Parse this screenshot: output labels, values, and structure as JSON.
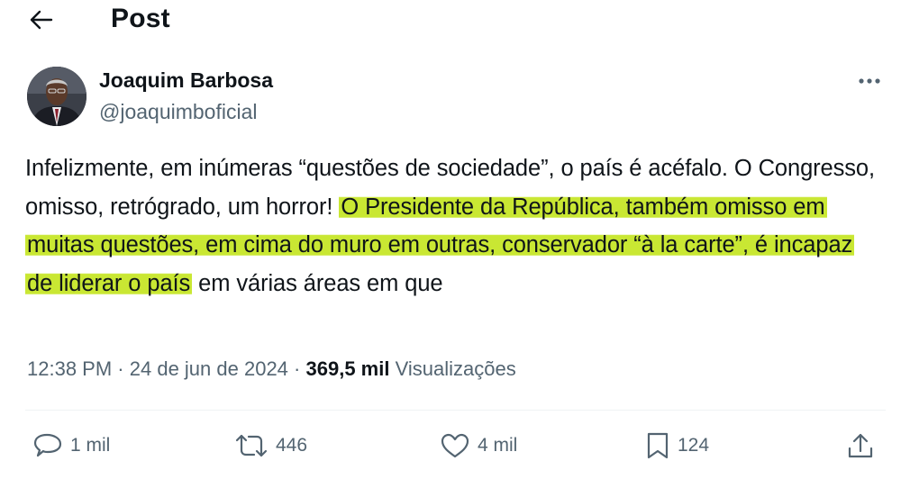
{
  "header": {
    "title": "Post",
    "back_icon": "arrow-left-icon"
  },
  "author": {
    "name": "Joaquim Barbosa",
    "handle": "@joaquimboficial"
  },
  "post": {
    "text_before": "Infelizmente, em inúmeras “questões de sociedade”, o país é acéfalo. O Congresso, omisso, retrógrado, um horror! ",
    "text_highlighted": "O Presidente da República, também omisso em muitas questões, em cima do muro em outras, conservador “à la carte”, é incapaz de liderar o país",
    "text_after": " em várias áreas em que",
    "highlight_color": "#c6e628"
  },
  "meta": {
    "time": "12:38 PM",
    "separator": "·",
    "date": "24 de jun de 2024",
    "views_count": "369,5 mil",
    "views_label": "Visualizações"
  },
  "actions": {
    "reply": {
      "icon": "reply-icon",
      "count": "1 mil"
    },
    "repost": {
      "icon": "repost-icon",
      "count": "446"
    },
    "like": {
      "icon": "heart-icon",
      "count": "4 mil"
    },
    "bookmark": {
      "icon": "bookmark-icon",
      "count": "124"
    },
    "share": {
      "icon": "share-icon"
    }
  }
}
